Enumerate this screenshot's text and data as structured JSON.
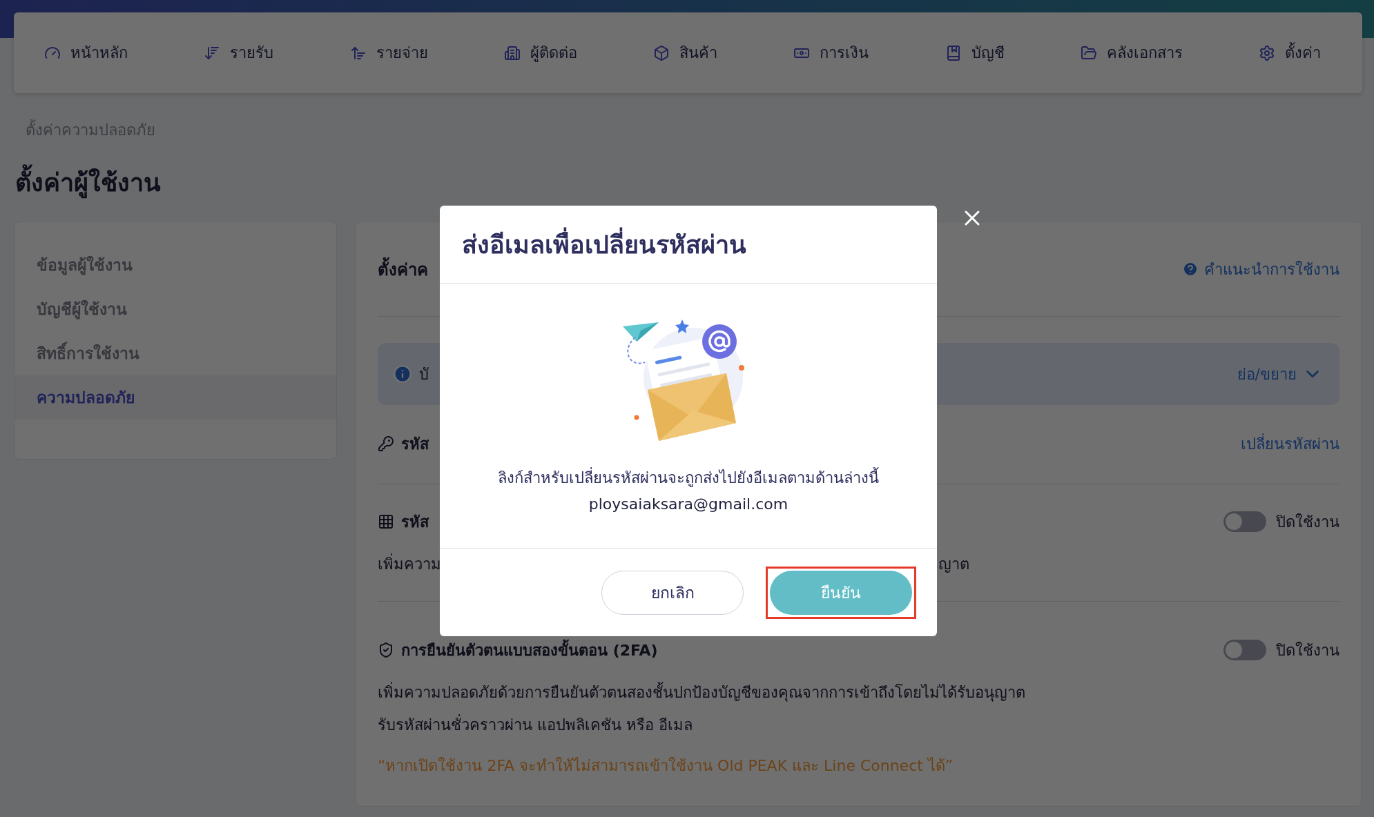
{
  "nav": {
    "items": [
      {
        "label": "หน้าหลัก"
      },
      {
        "label": "รายรับ"
      },
      {
        "label": "รายจ่าย"
      },
      {
        "label": "ผู้ติดต่อ"
      },
      {
        "label": "สินค้า"
      },
      {
        "label": "การเงิน"
      },
      {
        "label": "บัญชี"
      },
      {
        "label": "คลังเอกสาร"
      },
      {
        "label": "ตั้งค่า"
      }
    ]
  },
  "breadcrumb": "ตั้งค่าความปลอดภัย",
  "page_title": "ตั้งค่าผู้ใช้งาน",
  "sidebar": {
    "items": [
      {
        "label": "ข้อมูลผู้ใช้งาน",
        "selected": false
      },
      {
        "label": "บัญชีผู้ใช้งาน",
        "selected": false
      },
      {
        "label": "สิทธิ์การใช้งาน",
        "selected": false
      },
      {
        "label": "ความปลอดภัย",
        "selected": true
      }
    ]
  },
  "panel": {
    "title": "ตั้งค่าค",
    "help_link": "คำแนะนำการใช้งาน",
    "info": {
      "text": "บั",
      "toggle_label": "ย่อ/ขยาย"
    },
    "sections": [
      {
        "kind": "link",
        "title": "รหัส",
        "action": "เปลี่ยนรหัสผ่าน"
      },
      {
        "kind": "toggle",
        "title": "รหัส",
        "on": false,
        "state_label": "ปิดใช้งาน",
        "description": [
          "เพิ่มความ"
        ],
        "description_tail": "ญาต"
      },
      {
        "kind": "toggle",
        "title": "การยืนยันตัวตนแบบสองขั้นตอน (2FA)",
        "on": false,
        "state_label": "ปิดใช้งาน",
        "description": [
          "เพิ่มความปลอดภัยด้วยการยืนยันตัวตนสองชั้นปกป้องบัญชีของคุณจากการเข้าถึงโดยไม่ได้รับอนุญาต",
          "รับรหัสผ่านชั่วคราวผ่าน แอปพลิเคชัน หรือ อีเมล"
        ],
        "warning": "“หากเปิดใช้งาน 2FA จะทำให้ไม่สามารถเข้าใช้งาน Old PEAK และ Line Connect ได้”"
      }
    ]
  },
  "modal": {
    "title": "ส่งอีเมลเพื่อเปลี่ยนรหัสผ่าน",
    "message": "ลิงก์สำหรับเปลี่ยนรหัสผ่านจะถูกส่งไปยังอีเมลตามด้านล่างนี้",
    "email": "ploysaiaksara@gmail.com",
    "buttons": [
      {
        "kind": "secondary",
        "label": "ยกเลิก",
        "highlighted": false
      },
      {
        "kind": "primary",
        "label": "ยืนยัน",
        "highlighted": true
      }
    ]
  }
}
